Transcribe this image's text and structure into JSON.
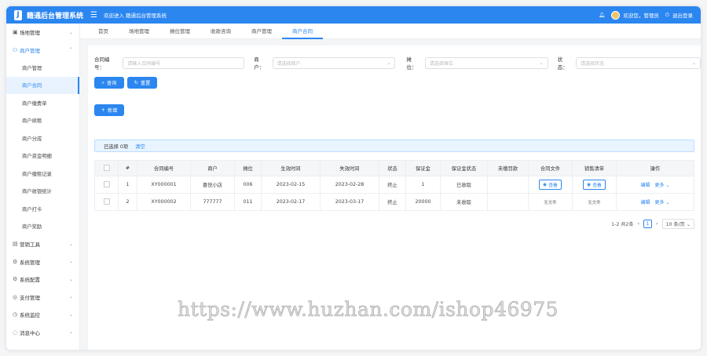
{
  "app": {
    "logo_letter": "J",
    "title": "籍通后台管理系统",
    "welcome": "欢迎进入 籍通后台管理系统",
    "user": "欢迎您，管理员",
    "logout": "退出登录",
    "brand_color": "#2b86f0"
  },
  "sidebar": {
    "groups_top": [
      {
        "label": "场地管理",
        "icon": "building-icon"
      }
    ],
    "open_group": {
      "label": "商户管理",
      "icon": "merchant-icon"
    },
    "sub_items": [
      {
        "label": "商户管理"
      },
      {
        "label": "商户合同"
      },
      {
        "label": "商户缴费单"
      },
      {
        "label": "商户续租"
      },
      {
        "label": "商户分成"
      },
      {
        "label": "商户资金明细"
      },
      {
        "label": "商户缴租记录"
      },
      {
        "label": "商户收银统计"
      },
      {
        "label": "商户打卡"
      },
      {
        "label": "商户奖励"
      }
    ],
    "groups_bottom": [
      {
        "label": "营销工具",
        "icon": "marketing-icon"
      },
      {
        "label": "系统管理",
        "icon": "settings-icon"
      },
      {
        "label": "系统配置",
        "icon": "config-icon"
      },
      {
        "label": "支付管理",
        "icon": "payment-icon"
      },
      {
        "label": "系统监控",
        "icon": "monitor-icon"
      },
      {
        "label": "消息中心",
        "icon": "message-icon"
      }
    ]
  },
  "tabs": [
    "首页",
    "场地管理",
    "摊位管理",
    "收款咨询",
    "商户管理",
    "商户合同"
  ],
  "filters": {
    "contract_label": "合同编号：",
    "contract_placeholder": "请输入合同编号",
    "merchant_label": "商户：",
    "merchant_placeholder": "请选择商户",
    "booth_label": "摊位：",
    "booth_placeholder": "请选择摊位",
    "status_label": "状态：",
    "status_placeholder": "请选择状态",
    "search": "查询",
    "reset": "重置",
    "add": "新增"
  },
  "selection": {
    "text": "已选择 0项",
    "clear": "清空"
  },
  "table": {
    "headers": [
      "#",
      "合同编号",
      "商户",
      "摊位",
      "生效时间",
      "失效时间",
      "状态",
      "保证金",
      "保证金状态",
      "未缴罚款",
      "合同文件",
      "销售清单",
      "操作"
    ],
    "rows": [
      {
        "idx": "1",
        "code": "XY000001",
        "merchant": "喜悦小店",
        "booth": "006",
        "start": "2023-02-15",
        "end": "2023-02-28",
        "status": "终止",
        "deposit": "1",
        "deposit_status": "已收取",
        "fine": "",
        "contract_file": "查看",
        "sales_list": "查看",
        "edit": "编辑",
        "more": "更多"
      },
      {
        "idx": "2",
        "code": "XY000002",
        "merchant": "777777",
        "booth": "011",
        "start": "2023-02-17",
        "end": "2023-03-17",
        "status": "终止",
        "deposit": "20000",
        "deposit_status": "未收取",
        "fine": "",
        "contract_file": "无文件",
        "sales_list": "无文件",
        "edit": "编辑",
        "more": "更多"
      }
    ]
  },
  "pagination": {
    "summary": "1-2 共2条",
    "current": "1",
    "page_size": "10 条/页"
  },
  "watermark": "https://www.huzhan.com/ishop46975"
}
